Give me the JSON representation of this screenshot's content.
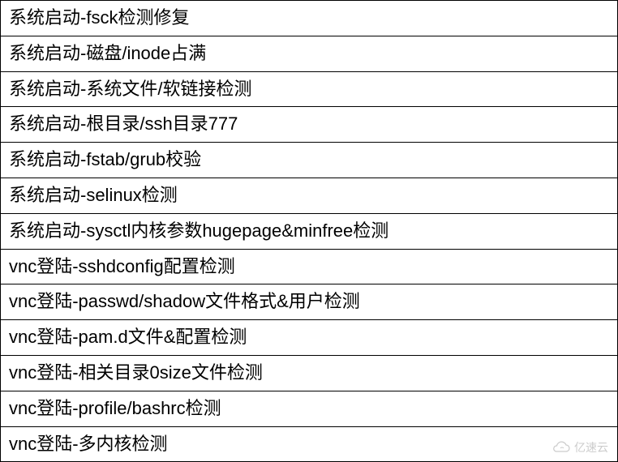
{
  "table": {
    "rows": [
      {
        "text": "系统启动-fsck检测修复"
      },
      {
        "text": "系统启动-磁盘/inode占满"
      },
      {
        "text": "系统启动-系统文件/软链接检测"
      },
      {
        "text": "系统启动-根目录/ssh目录777"
      },
      {
        "text": "系统启动-fstab/grub校验"
      },
      {
        "text": "系统启动-selinux检测"
      },
      {
        "text": "系统启动-sysctl内核参数hugepage&minfree检测"
      },
      {
        "text": "vnc登陆-sshdconfig配置检测"
      },
      {
        "text": "vnc登陆-passwd/shadow文件格式&用户检测"
      },
      {
        "text": "vnc登陆-pam.d文件&配置检测"
      },
      {
        "text": "vnc登陆-相关目录0size文件检测"
      },
      {
        "text": "vnc登陆-profile/bashrc检测"
      },
      {
        "text": "vnc登陆-多内核检测"
      }
    ]
  },
  "watermark": {
    "text": "亿速云"
  }
}
